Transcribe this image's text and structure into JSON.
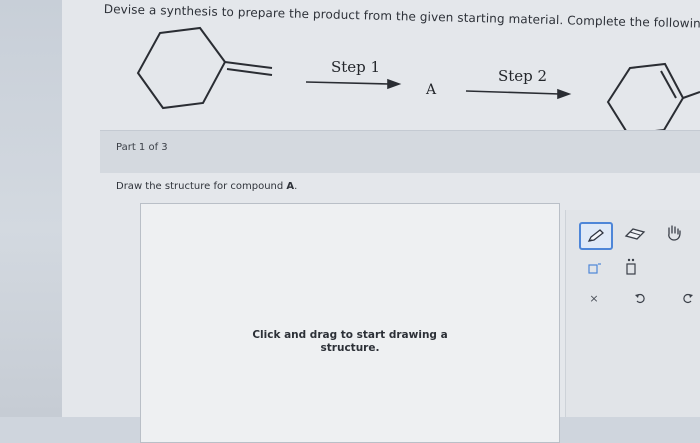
{
  "instruction": "Devise a synthesis to prepare the product from the given starting material. Complete the following reaction scheme.",
  "scheme": {
    "step1_label": "Step 1",
    "step2_label": "Step 2",
    "intermediate_label": "A"
  },
  "part": {
    "label": "Part 1 of 3",
    "question_prefix": "Draw the structure for compound ",
    "question_bold": "A",
    "question_suffix": "."
  },
  "canvas": {
    "hint_line1": "Click and drag to start drawing a",
    "hint_line2": "structure."
  },
  "toolbar": {
    "tools": [
      "pencil-icon",
      "eraser-icon",
      "hand-icon",
      "template-icon",
      "lone-pair-icon",
      "clear-icon",
      "undo-icon",
      "redo-icon"
    ],
    "clear_glyph": "×",
    "accent_color": "#4e86d8"
  }
}
